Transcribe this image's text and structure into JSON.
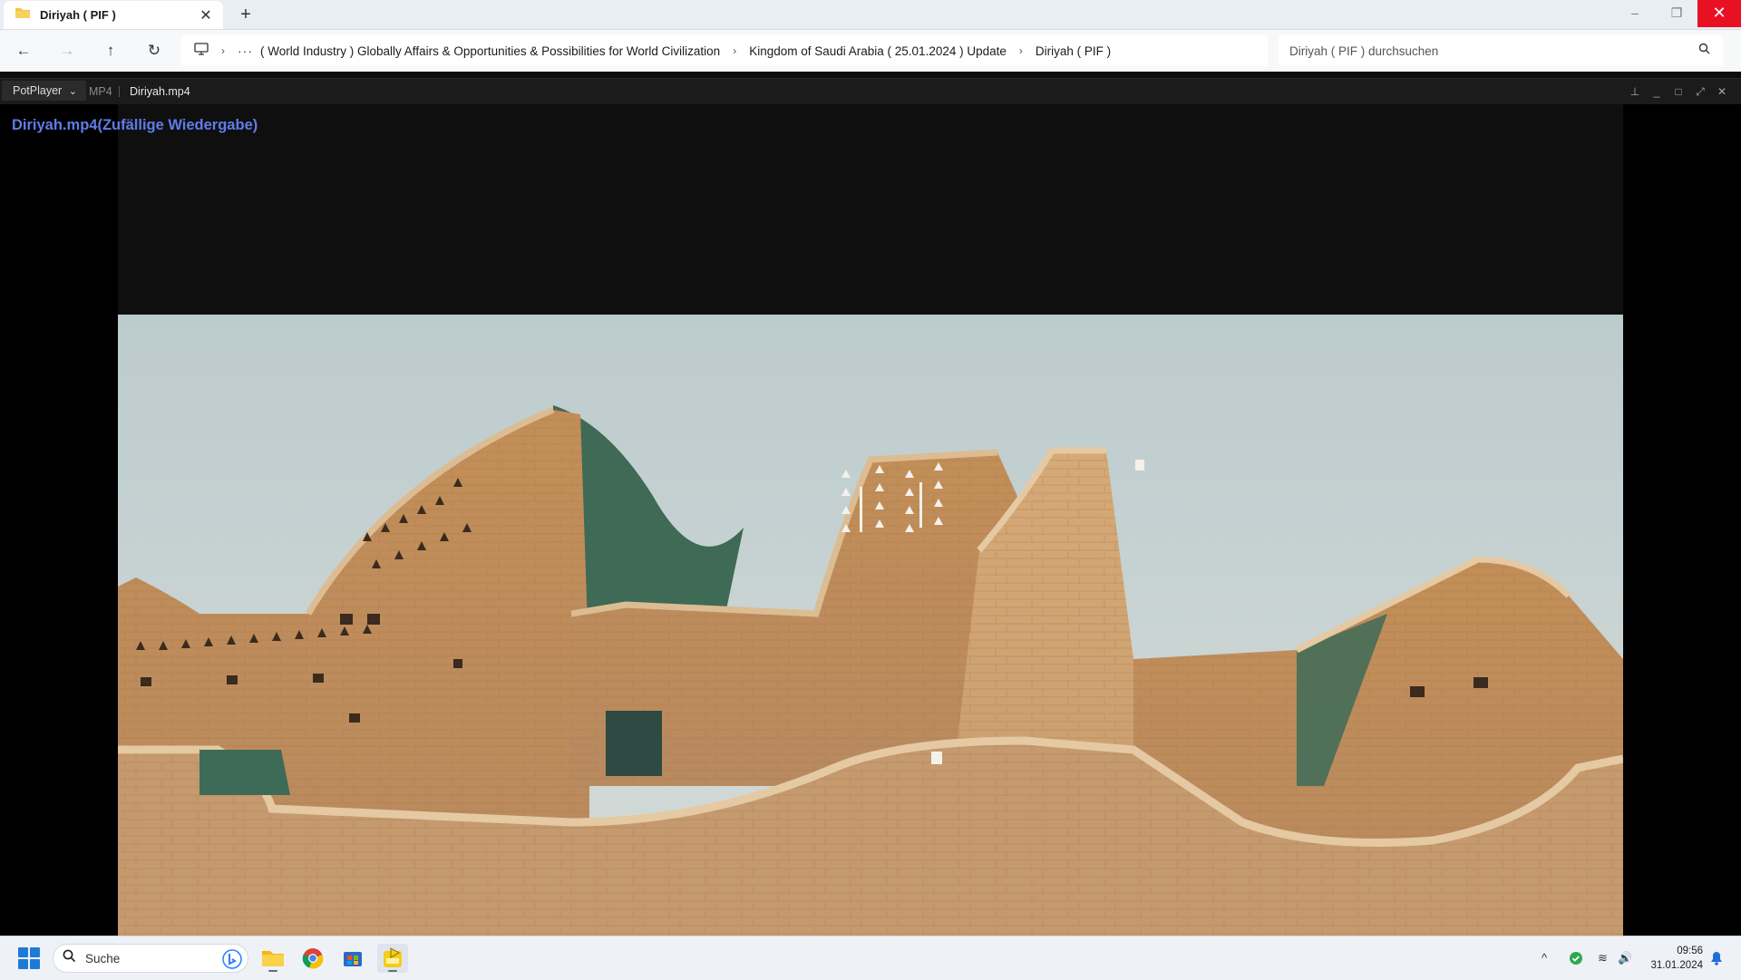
{
  "explorer": {
    "tab_title": "Diriyah ( PIF )",
    "tab_close_glyph": "✕",
    "new_tab_glyph": "+",
    "window_controls": {
      "minimize": "–",
      "restore": "❐",
      "close": "✕"
    },
    "nav": {
      "back": "←",
      "forward": "→",
      "up": "↑",
      "refresh": "↻"
    },
    "path_more": "···",
    "breadcrumbs": [
      "( World Industry ) Globally Affairs & Opportunities & Possibilities for World Civilization",
      "Kingdom of Saudi Arabia ( 25.01.2024 ) Update",
      "Diriyah ( PIF )"
    ],
    "breadcrumb_separator": "›",
    "search_placeholder": "Diriyah ( PIF ) durchsuchen",
    "icons": [
      "folder-icon",
      "monitor-icon",
      "search-icon"
    ]
  },
  "player": {
    "menu_label": "PotPlayer",
    "menu_chevron": "⌄",
    "format": "MP4",
    "filename": "Diriyah.mp4",
    "osd_title": "Diriyah.mp4(Zufällige Wiedergabe)",
    "controls": {
      "pin": "⊥",
      "minimize": "_",
      "maximize": "□",
      "fullscreen": "⤢",
      "close": "✕"
    }
  },
  "taskbar": {
    "search_placeholder": "Suche",
    "apps": [
      "file-explorer-icon",
      "chrome-icon",
      "store-icon",
      "potplayer-icon"
    ],
    "tray": {
      "chevron": "^",
      "wifi": "≋",
      "volume": "🔊"
    },
    "time": "09:56",
    "date": "31.01.2024"
  },
  "colors": {
    "osd_text": "#5f7de8",
    "close_red": "#e81123",
    "sky": "#c6d3d6",
    "mud": "#c1925f",
    "roof_green": "#3f6a55"
  }
}
